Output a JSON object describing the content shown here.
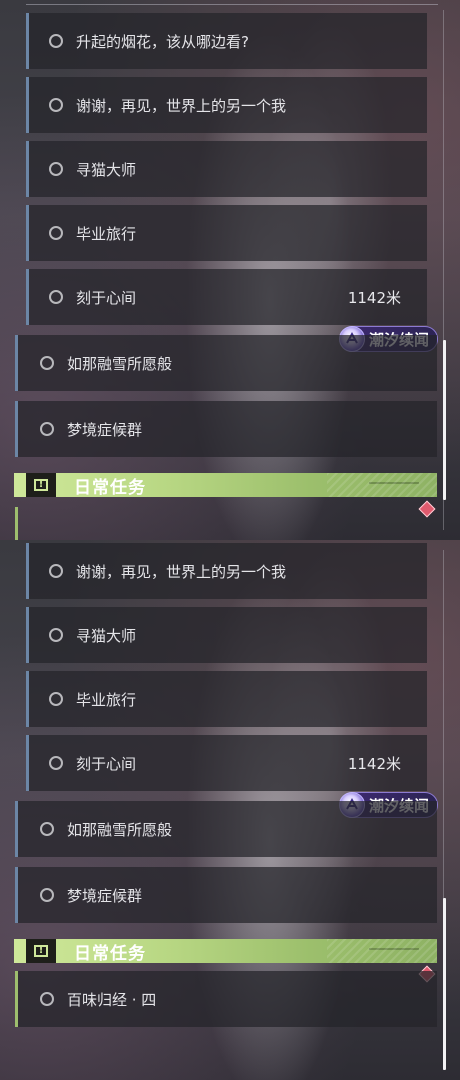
{
  "panel1": {
    "sub_quests": [
      {
        "label": "升起的烟花，该从哪边看?"
      },
      {
        "label": "谢谢，再见，世界上的另一个我"
      },
      {
        "label": "寻猫大师"
      },
      {
        "label": "毕业旅行"
      },
      {
        "label": "刻于心间",
        "distance": "1142米"
      }
    ],
    "badge": "潮汐续闻",
    "main_quests": [
      {
        "label": "如那融雪所愿般"
      },
      {
        "label": "梦境症候群"
      }
    ],
    "daily_title": "日常任务"
  },
  "panel2": {
    "sub_quests": [
      {
        "label": "谢谢，再见，世界上的另一个我"
      },
      {
        "label": "寻猫大师"
      },
      {
        "label": "毕业旅行"
      },
      {
        "label": "刻于心间",
        "distance": "1142米"
      }
    ],
    "badge": "潮汐续闻",
    "main_quests": [
      {
        "label": "如那融雪所愿般"
      },
      {
        "label": "梦境症候群"
      }
    ],
    "daily_title": "日常任务",
    "daily_quests": [
      {
        "label": "百味归经 · 四"
      }
    ]
  },
  "colors": {
    "accent_blue": "#6c86a6",
    "daily_green": "#b9d884",
    "badge_purple": "#3e2a72",
    "marker_red": "#e05a6e"
  },
  "icons": [
    "quest-circle-icon",
    "tidal-badge-icon",
    "daily-task-icon",
    "quest-marker-diamond-icon"
  ]
}
